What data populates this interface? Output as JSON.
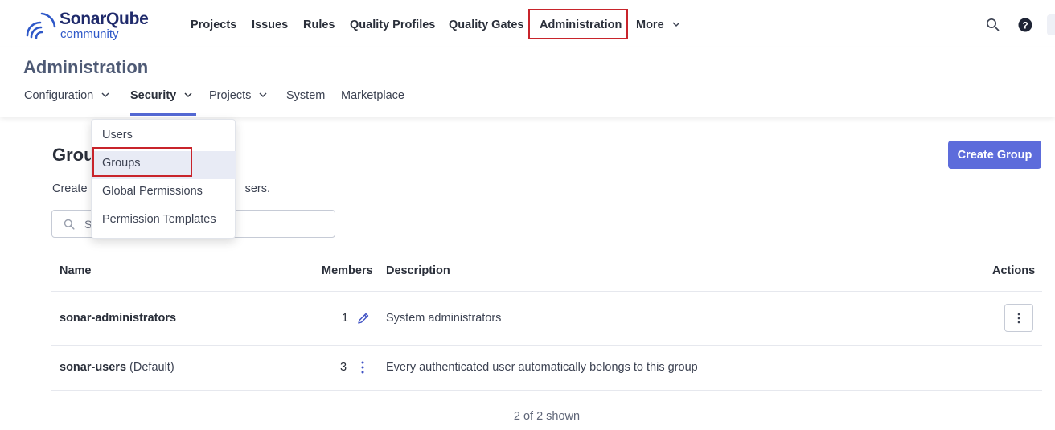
{
  "brand": {
    "name": "SonarQube",
    "edition": "community",
    "colors": {
      "dark": "#1f2a6b",
      "blue": "#2e58c8",
      "accent": "#5d6cdb",
      "highlight": "#c8242b"
    }
  },
  "topnav": {
    "items": [
      {
        "label": "Projects"
      },
      {
        "label": "Issues"
      },
      {
        "label": "Rules"
      },
      {
        "label": "Quality Profiles"
      },
      {
        "label": "Quality Gates"
      },
      {
        "label": "Administration"
      },
      {
        "label": "More"
      }
    ],
    "icons": [
      "search-icon",
      "help-icon"
    ]
  },
  "admin": {
    "title": "Administration",
    "subnav": [
      {
        "label": "Configuration"
      },
      {
        "label": "Security"
      },
      {
        "label": "Projects"
      },
      {
        "label": "System"
      },
      {
        "label": "Marketplace"
      }
    ],
    "active_subnav": "Security"
  },
  "security_menu": {
    "items": [
      {
        "label": "Users"
      },
      {
        "label": "Groups"
      },
      {
        "label": "Global Permissions"
      },
      {
        "label": "Permission Templates"
      }
    ],
    "selected": "Groups"
  },
  "groups": {
    "title_visible": "Grou",
    "desc_start": "Create",
    "desc_end": "sers.",
    "search_placeholder": "S",
    "create_button": "Create Group",
    "columns": {
      "name": "Name",
      "members": "Members",
      "description": "Description",
      "actions": "Actions"
    },
    "rows": [
      {
        "name": "sonar-administrators",
        "suffix": "",
        "members": "1",
        "description": "System administrators"
      },
      {
        "name": "sonar-users",
        "suffix": "(Default)",
        "members": "3",
        "description": "Every authenticated user automatically belongs to this group"
      }
    ],
    "footer": "2 of 2 shown"
  }
}
